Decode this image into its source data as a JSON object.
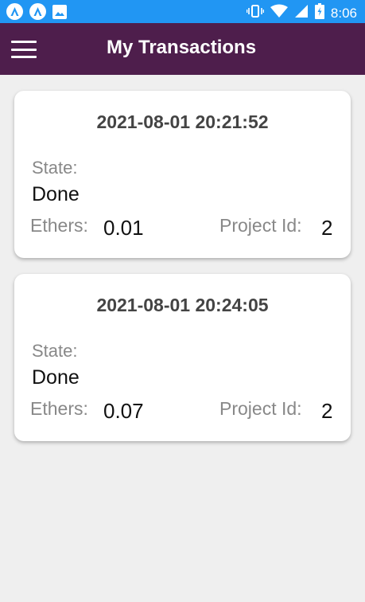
{
  "status_bar": {
    "time": "8:06",
    "left_icons": [
      "app-notification-icon",
      "app-notification-icon",
      "image-icon"
    ],
    "right_icons": [
      "vibrate-icon",
      "wifi-icon",
      "signal-icon",
      "battery-icon"
    ],
    "color": "#2196f3"
  },
  "app_bar": {
    "title": "My Transactions",
    "color": "#4e1e4c",
    "menu_icon": "hamburger-menu-icon"
  },
  "transactions": [
    {
      "date": "2021-08-01 20:21:52",
      "state_label": "State:",
      "state": "Done",
      "ethers_label": "Ethers:",
      "ethers": "0.01",
      "project_label": "Project Id:",
      "project_id": "2"
    },
    {
      "date": "2021-08-01 20:24:05",
      "state_label": "State:",
      "state": "Done",
      "ethers_label": "Ethers:",
      "ethers": "0.07",
      "project_label": "Project Id:",
      "project_id": "2"
    }
  ]
}
